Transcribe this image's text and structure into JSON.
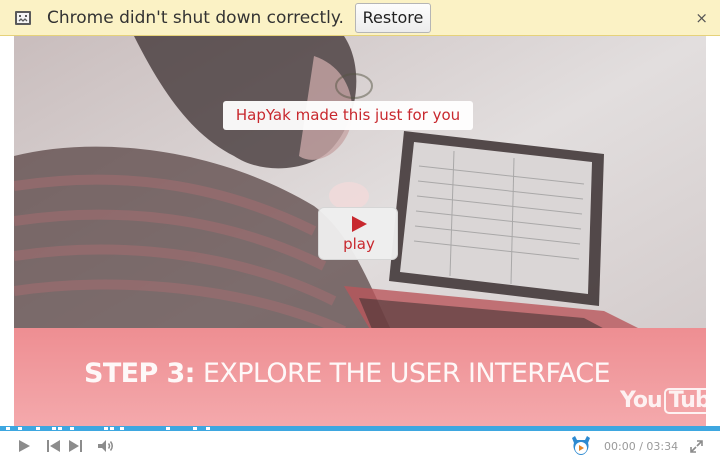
{
  "infobar": {
    "message": "Chrome didn't shut down correctly.",
    "restore_label": "Restore",
    "close_glyph": "×",
    "icon": "crash-warning-icon"
  },
  "video": {
    "banner_text": "HapYak made this just for you",
    "play_label": "play",
    "step_prefix": "STEP 3:",
    "step_title": " EXPLORE THE USER INTERFACE",
    "watermark_you": "You",
    "watermark_tube": "Tube"
  },
  "player": {
    "progress_color": "#3ea7e0",
    "time_current": "00:00",
    "time_separator": "/",
    "time_total": "03:34",
    "icons": [
      "play-icon",
      "previous-icon",
      "next-icon",
      "volume-icon",
      "hapyak-logo-icon",
      "fullscreen-icon"
    ]
  },
  "colors": {
    "accent_red": "#c8282e",
    "infobar_bg": "#fbf2c5"
  }
}
